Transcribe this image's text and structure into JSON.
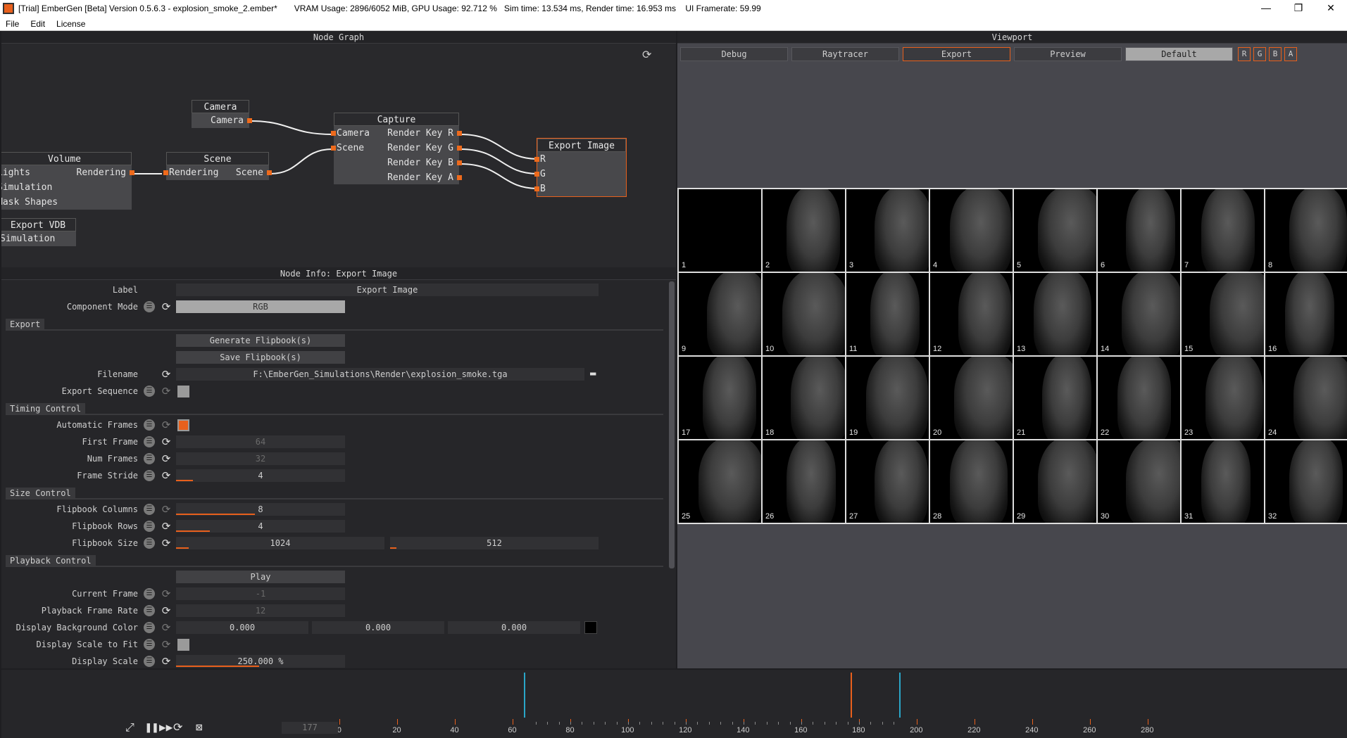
{
  "window": {
    "title": "[Trial] EmberGen [Beta] Version 0.5.6.3 - explosion_smoke_2.ember*",
    "stats": "VRAM Usage: 2896/6052 MiB, GPU Usage: 92.712 %   Sim time: 13.534 ms, Render time: 16.953 ms    UI Framerate: 59.99",
    "controls": [
      "—",
      "❐",
      "✕"
    ]
  },
  "menu": [
    "File",
    "Edit",
    "License"
  ],
  "node_graph": {
    "title": "Node Graph",
    "nodes": {
      "camera": {
        "title": "Camera",
        "out": "Camera"
      },
      "volume": {
        "title": "Volume",
        "rows": [
          "Lights",
          "Simulation",
          "Mask Shapes"
        ],
        "out": "Rendering"
      },
      "scene": {
        "title": "Scene",
        "in": "Rendering",
        "out": "Scene"
      },
      "capture": {
        "title": "Capture",
        "in": [
          "Camera",
          "Scene"
        ],
        "out": [
          "Render Key R",
          "Render Key G",
          "Render Key B",
          "Render Key A"
        ]
      },
      "export_image": {
        "title": "Export Image",
        "in": [
          "R",
          "G",
          "B"
        ]
      },
      "export_vdb": {
        "title": "Export VDB",
        "in": "Simulation"
      }
    }
  },
  "node_info": {
    "title": "Node Info: Export Image",
    "label": {
      "label": "Label",
      "value": "Export Image"
    },
    "component_mode": {
      "label": "Component Mode",
      "value": "RGB"
    },
    "sections": {
      "export": "Export",
      "timing": "Timing Control",
      "size": "Size Control",
      "playback": "Playback Control"
    },
    "generate_button": "Generate Flipbook(s)",
    "save_button": "Save Flipbook(s)",
    "filename": {
      "label": "Filename",
      "value": "F:\\EmberGen_Simulations\\Render\\explosion_smoke.tga"
    },
    "export_sequence": {
      "label": "Export Sequence"
    },
    "automatic_frames": {
      "label": "Automatic Frames"
    },
    "first_frame": {
      "label": "First Frame",
      "value": "64"
    },
    "num_frames": {
      "label": "Num Frames",
      "value": "32"
    },
    "frame_stride": {
      "label": "Frame Stride",
      "value": "4"
    },
    "flipbook_columns": {
      "label": "Flipbook Columns",
      "value": "8"
    },
    "flipbook_rows": {
      "label": "Flipbook Rows",
      "value": "4"
    },
    "flipbook_size": {
      "label": "Flipbook Size",
      "width": "1024",
      "height": "512"
    },
    "play_button": "Play",
    "current_frame": {
      "label": "Current Frame",
      "value": "-1"
    },
    "playback_frame_rate": {
      "label": "Playback Frame Rate",
      "value": "12"
    },
    "display_bg_color": {
      "label": "Display Background Color",
      "r": "0.000",
      "g": "0.000",
      "b": "0.000",
      "swatch": "#000000"
    },
    "display_scale_fit": {
      "label": "Display Scale to Fit"
    },
    "display_scale": {
      "label": "Display Scale",
      "value": "250.000 %"
    }
  },
  "viewport": {
    "title": "Viewport",
    "tabs": [
      "Debug",
      "Raytracer",
      "Export",
      "Preview",
      "Default"
    ],
    "channels": [
      "R",
      "G",
      "B",
      "A"
    ],
    "frames": [
      "1",
      "2",
      "3",
      "4",
      "5",
      "6",
      "7",
      "8",
      "9",
      "10",
      "11",
      "12",
      "13",
      "14",
      "15",
      "16",
      "17",
      "18",
      "19",
      "20",
      "21",
      "22",
      "23",
      "24",
      "25",
      "26",
      "27",
      "28",
      "29",
      "30",
      "31",
      "32"
    ]
  },
  "timeline": {
    "current_frame": "177",
    "ticks": [
      "0",
      "20",
      "40",
      "60",
      "80",
      "100",
      "120",
      "140",
      "160",
      "180",
      "200",
      "220",
      "240",
      "260",
      "280"
    ],
    "markers": [
      {
        "frame": 64,
        "color": "#2aa6c8"
      },
      {
        "frame": 177,
        "color": "#e8601c"
      },
      {
        "frame": 194,
        "color": "#2aa6c8"
      }
    ]
  },
  "colors": {
    "accent": "#e8601c",
    "cyan": "#2aa6c8"
  }
}
